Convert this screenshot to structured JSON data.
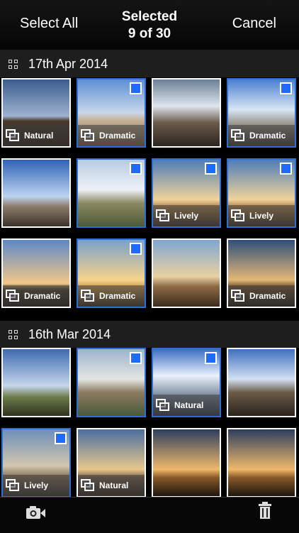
{
  "header": {
    "select_all_label": "Select All",
    "title_line1": "Selected",
    "title_line2": "9 of 30",
    "cancel_label": "Cancel"
  },
  "sections": [
    {
      "date": "17th Apr 2014",
      "tiles": [
        {
          "caption": "Natural",
          "selected": false,
          "scene": "palace at dusk"
        },
        {
          "caption": "Dramatic",
          "selected": true,
          "scene": "ornate building facade"
        },
        {
          "caption": "",
          "selected": false,
          "scene": "courtyard with sun"
        },
        {
          "caption": "Dramatic",
          "selected": true,
          "scene": "skyline with sun"
        },
        {
          "caption": "",
          "selected": false,
          "scene": "ferris wheel under clouds"
        },
        {
          "caption": "",
          "selected": true,
          "scene": "tree lined park"
        },
        {
          "caption": "Lively",
          "selected": true,
          "scene": "skyline at sunset"
        },
        {
          "caption": "Lively",
          "selected": true,
          "scene": "skyline at sunset"
        },
        {
          "caption": "Dramatic",
          "selected": false,
          "scene": "eiffel tower at dusk"
        },
        {
          "caption": "Dramatic",
          "selected": true,
          "scene": "eiffel tower haze"
        },
        {
          "caption": "",
          "selected": false,
          "scene": "statue against sky"
        },
        {
          "caption": "Dramatic",
          "selected": false,
          "scene": "glowing horizon"
        }
      ]
    },
    {
      "date": "16th Mar 2014",
      "tiles": [
        {
          "caption": "",
          "selected": false,
          "scene": "eiffel tower with tree"
        },
        {
          "caption": "",
          "selected": true,
          "scene": "historic building in field"
        },
        {
          "caption": "Natural",
          "selected": true,
          "scene": "sunburst sky"
        },
        {
          "caption": "",
          "selected": false,
          "scene": "street with cars"
        },
        {
          "caption": "Lively",
          "selected": true,
          "scene": "building facade"
        },
        {
          "caption": "Natural",
          "selected": false,
          "scene": "sunset cityscape"
        },
        {
          "caption": "",
          "selected": false,
          "scene": "eiffel tower at sunset"
        },
        {
          "caption": "",
          "selected": false,
          "scene": "eiffel tower at sunset"
        }
      ]
    }
  ],
  "toolbar": {
    "camera_icon": "camera-add-icon",
    "trash_icon": "trash-icon"
  },
  "colors": {
    "selection_border": "#2d6fd6",
    "checkbox": "#1f6bff",
    "section_header_bg": "#1e1e1e"
  }
}
